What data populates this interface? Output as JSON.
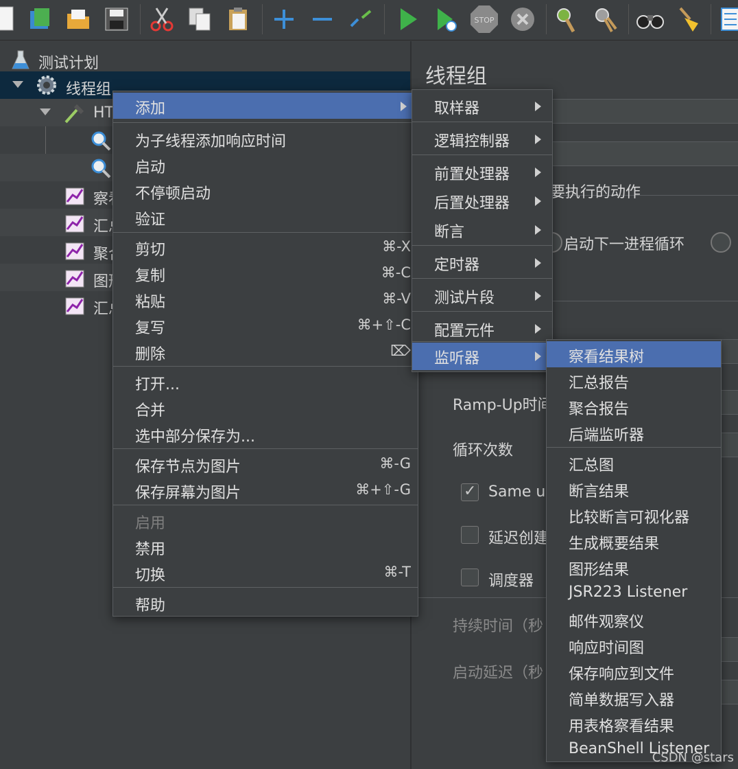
{
  "toolbar": {
    "icons": [
      "new-icon",
      "templates-icon",
      "open-icon",
      "save-icon",
      "cut-icon",
      "copy-icon",
      "paste-icon",
      "expand-icon",
      "collapse-icon",
      "toggle-icon",
      "start-icon",
      "start-no-pause-icon",
      "stop-icon",
      "shutdown-icon",
      "clear-icon",
      "clear-all-icon",
      "search-icon",
      "reset-search-icon",
      "function-helper-icon"
    ],
    "stop_label": "STOP"
  },
  "tree": {
    "test_plan": "测试计划",
    "thread_group": "线程组",
    "http_prefix": "HT",
    "listeners": [
      "察看",
      "汇总",
      "聚合",
      "图形",
      "汇总"
    ]
  },
  "panel": {
    "title": "线程组",
    "action_label": "要执行的动作",
    "next_loop_label": "启动下一进程循环",
    "rampup_label": "Ramp-Up时间",
    "loop_label": "循环次数",
    "same_user_label": "Same us",
    "delay_create_label": "延迟创建",
    "scheduler_label": "调度器",
    "duration_label": "持续时间（秒",
    "startup_delay_label": "启动延迟（秒"
  },
  "main_menu": {
    "add": "添加",
    "add_response_time": "为子线程添加响应时间",
    "start": "启动",
    "start_no_pause": "不停顿启动",
    "validate": "验证",
    "cut": "剪切",
    "cut_short": "⌘-X",
    "copy": "复制",
    "copy_short": "⌘-C",
    "paste": "粘贴",
    "paste_short": "⌘-V",
    "duplicate": "复写",
    "duplicate_short": "⌘+⇧-C",
    "delete": "删除",
    "delete_short": "⌦",
    "open": "打开...",
    "merge": "合并",
    "save_selection": "选中部分保存为...",
    "save_node_image": "保存节点为图片",
    "save_node_image_short": "⌘-G",
    "save_screen_image": "保存屏幕为图片",
    "save_screen_image_short": "⌘+⇧-G",
    "enable": "启用",
    "disable": "禁用",
    "toggle": "切换",
    "toggle_short": "⌘-T",
    "help": "帮助"
  },
  "add_menu": {
    "sampler": "取样器",
    "logic_controller": "逻辑控制器",
    "pre_processor": "前置处理器",
    "post_processor": "后置处理器",
    "assertion": "断言",
    "timer": "定时器",
    "test_fragment": "测试片段",
    "config_element": "配置元件",
    "listener": "监听器"
  },
  "listener_menu": {
    "group1": [
      "察看结果树",
      "汇总报告",
      "聚合报告",
      "后端监听器"
    ],
    "group2": [
      "汇总图",
      "断言结果",
      "比较断言可视化器",
      "生成概要结果",
      "图形结果",
      "JSR223 Listener",
      "邮件观察仪",
      "响应时间图",
      "保存响应到文件",
      "简单数据写入器",
      "用表格察看结果",
      "BeanShell Listener"
    ]
  },
  "watermark": "CSDN @stars",
  "colors": {
    "background": "#3c3f41",
    "menu_highlight": "#4b6eaf",
    "tree_selection": "#0d293e"
  }
}
